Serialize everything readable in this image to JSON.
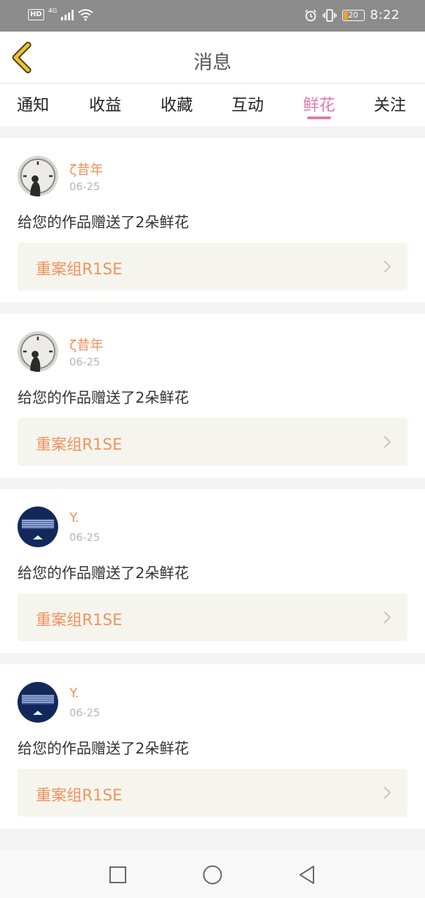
{
  "status_bar": {
    "hd": "HD",
    "network": "4G",
    "battery": "20",
    "time": "8:22",
    "icons": [
      "signal-icon",
      "wifi-icon",
      "alarm-icon",
      "vibrate-icon",
      "battery-icon"
    ]
  },
  "header": {
    "title": "消息",
    "back_icon": "chevron-left-icon",
    "back_color": "#e8c23a"
  },
  "tabs": [
    {
      "label": "通知",
      "active": false
    },
    {
      "label": "收益",
      "active": false
    },
    {
      "label": "收藏",
      "active": false
    },
    {
      "label": "互动",
      "active": false
    },
    {
      "label": "鲜花",
      "active": true
    },
    {
      "label": "关注",
      "active": false
    }
  ],
  "messages": [
    {
      "username": "ζ昔年",
      "date": "06-25",
      "text": "给您的作品赠送了2朵鲜花",
      "work_title": "重案组R1SE",
      "avatar": "clock-avatar"
    },
    {
      "username": "ζ昔年",
      "date": "06-25",
      "text": "给您的作品赠送了2朵鲜花",
      "work_title": "重案组R1SE",
      "avatar": "clock-avatar"
    },
    {
      "username": "Y.",
      "date": "06-25",
      "text": "给您的作品赠送了2朵鲜花",
      "work_title": "重案组R1SE",
      "avatar": "navy-avatar"
    },
    {
      "username": "Y.",
      "date": "06-25",
      "text": "给您的作品赠送了2朵鲜花",
      "work_title": "重案组R1SE",
      "avatar": "navy-avatar"
    }
  ],
  "nav_bar": {
    "icons": [
      "recent-apps-icon",
      "home-icon",
      "back-icon"
    ]
  },
  "colors": {
    "accent_pink": "#e27ab0",
    "accent_orange": "#f1925e",
    "link_bg": "#f5f5ee"
  }
}
